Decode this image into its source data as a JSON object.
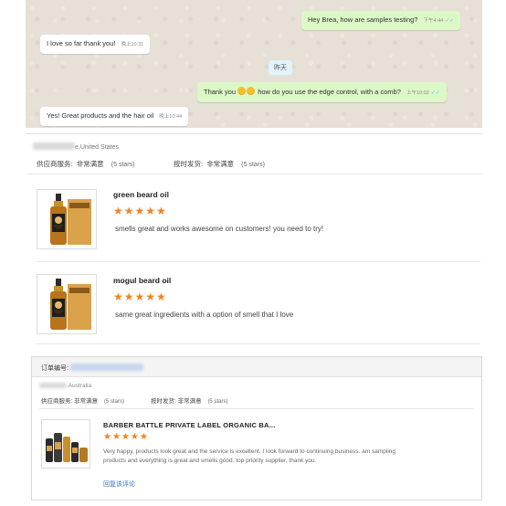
{
  "chat": {
    "messages": [
      {
        "dir": "out",
        "text": "Hey Brea, how are samples testing?",
        "time": "下午4:44"
      },
      {
        "dir": "in",
        "text": "I love so far thank you!",
        "time": "晚上10:31"
      },
      {
        "dir": "out",
        "text_after_emoji": " how do you use the edge control, with a comb?",
        "time": "上午10:02",
        "prefix": "Thank you"
      },
      {
        "dir": "in",
        "text": "Yes! Great products and the hair oil",
        "time": "晚上10:44"
      }
    ],
    "date_chip": "昨天",
    "ticks": "✓✓"
  },
  "review1": {
    "reviewer_country": "e,United States",
    "supplier_service_label": "供应商服务:",
    "supplier_service_value": "非常满意",
    "supplier_service_stars": "(5 stars)",
    "on_time_label": "按时发货:",
    "on_time_value": "非常满意",
    "on_time_stars": "(5 stars)",
    "products": [
      {
        "name": "green beard oil",
        "stars": "★★★★★",
        "comment": "smells great and works awesome on customers! you need to try!"
      },
      {
        "name": "mogul beard oil",
        "stars": "★★★★★",
        "comment": "same great ingredients with a option of smell that I love"
      }
    ]
  },
  "order": {
    "order_label": "订单编号:",
    "reviewer_country": ".Australia",
    "supplier_service_label": "供应商服务:",
    "supplier_service_value": "非常满意",
    "supplier_service_stars": "(5 stars)",
    "on_time_label": "按时发货:",
    "on_time_value": "非常满意",
    "on_time_stars": "(5 stars)",
    "product_title": "BARBER BATTLE PRIVATE LABEL ORGANIC BA...",
    "stars": "★★★★★",
    "comment": "Very happy, products look great and the service is excellent. I look forward to continuing business. am sampling products and everything is great and smells good. top priority supplier, thank you.",
    "reply_link": "回复该评论"
  },
  "colors": {
    "accent_orange": "#f5821f",
    "link_blue": "#3a6fc3",
    "bubble_out": "#dcf8c6"
  }
}
